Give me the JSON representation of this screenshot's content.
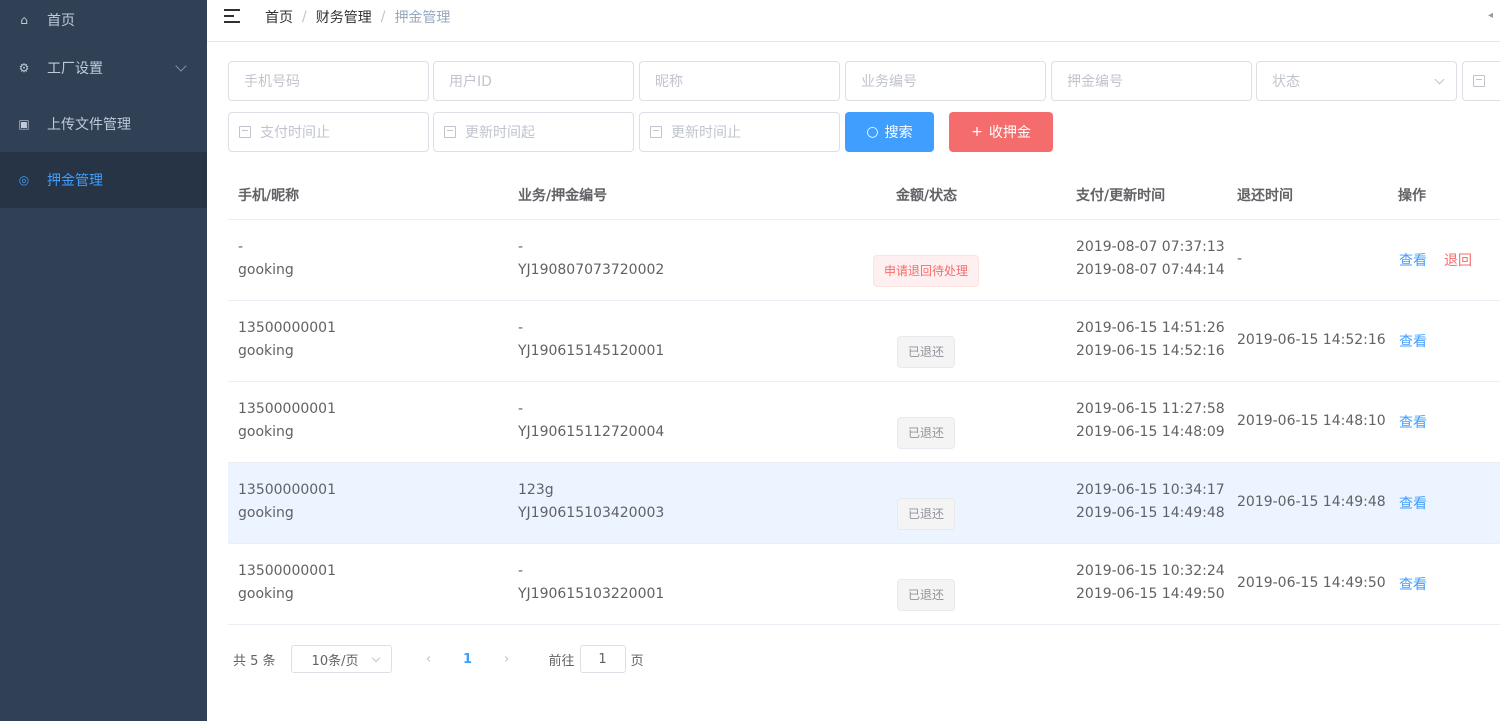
{
  "sidebar": {
    "items": [
      {
        "label": "首页",
        "icon": "home-icon"
      },
      {
        "label": "工厂设置",
        "icon": "gear-icon"
      },
      {
        "label": "上传文件管理",
        "icon": "upload-icon"
      },
      {
        "label": "押金管理",
        "icon": "deposit-icon"
      }
    ]
  },
  "breadcrumb": [
    "首页",
    "财务管理",
    "押金管理"
  ],
  "filters": {
    "phone": "手机号码",
    "user_id": "用户ID",
    "nickname": "昵称",
    "biz_no": "业务编号",
    "deposit_no": "押金编号",
    "status": "状态",
    "pay_end": "支付时间止",
    "update_start": "更新时间起",
    "update_end": "更新时间止"
  },
  "buttons": {
    "search": "搜索",
    "deposit": "收押金"
  },
  "table": {
    "headers": [
      "手机/昵称",
      "业务/押金编号",
      "金额/状态",
      "支付/更新时间",
      "退还时间",
      "操作"
    ],
    "rows": [
      {
        "phone": "-",
        "nick": "gooking",
        "biz": "-",
        "deposit_no": "YJ190807073720002",
        "status": "申请退回待处理",
        "status_type": "warn",
        "pay_time": "2019-08-07 07:37:13",
        "update_time": "2019-08-07 07:44:14",
        "refund_time": "-",
        "view": "查看",
        "back": "退回"
      },
      {
        "phone": "13500000001",
        "nick": "gooking",
        "biz": "-",
        "deposit_no": "YJ190615145120001",
        "status": "已退还",
        "status_type": "info",
        "pay_time": "2019-06-15 14:51:26",
        "update_time": "2019-06-15 14:52:16",
        "refund_time": "2019-06-15 14:52:16",
        "view": "查看"
      },
      {
        "phone": "13500000001",
        "nick": "gooking",
        "biz": "-",
        "deposit_no": "YJ190615112720004",
        "status": "已退还",
        "status_type": "info",
        "pay_time": "2019-06-15 11:27:58",
        "update_time": "2019-06-15 14:48:09",
        "refund_time": "2019-06-15 14:48:10",
        "view": "查看"
      },
      {
        "phone": "13500000001",
        "nick": "gooking",
        "biz": "123g",
        "deposit_no": "YJ190615103420003",
        "status": "已退还",
        "status_type": "info",
        "pay_time": "2019-06-15 10:34:17",
        "update_time": "2019-06-15 14:49:48",
        "refund_time": "2019-06-15 14:49:48",
        "view": "查看"
      },
      {
        "phone": "13500000001",
        "nick": "gooking",
        "biz": "-",
        "deposit_no": "YJ190615103220001",
        "status": "已退还",
        "status_type": "info",
        "pay_time": "2019-06-15 10:32:24",
        "update_time": "2019-06-15 14:49:50",
        "refund_time": "2019-06-15 14:49:50",
        "view": "查看"
      }
    ]
  },
  "pagination": {
    "total": "共 5 条",
    "size": "10条/页",
    "current": "1",
    "goto_label": "前往",
    "goto_value": "1",
    "page_label": "页"
  },
  "colors": {
    "sidebar_bg": "#304156",
    "primary": "#409eff",
    "danger": "#f56c6c"
  }
}
